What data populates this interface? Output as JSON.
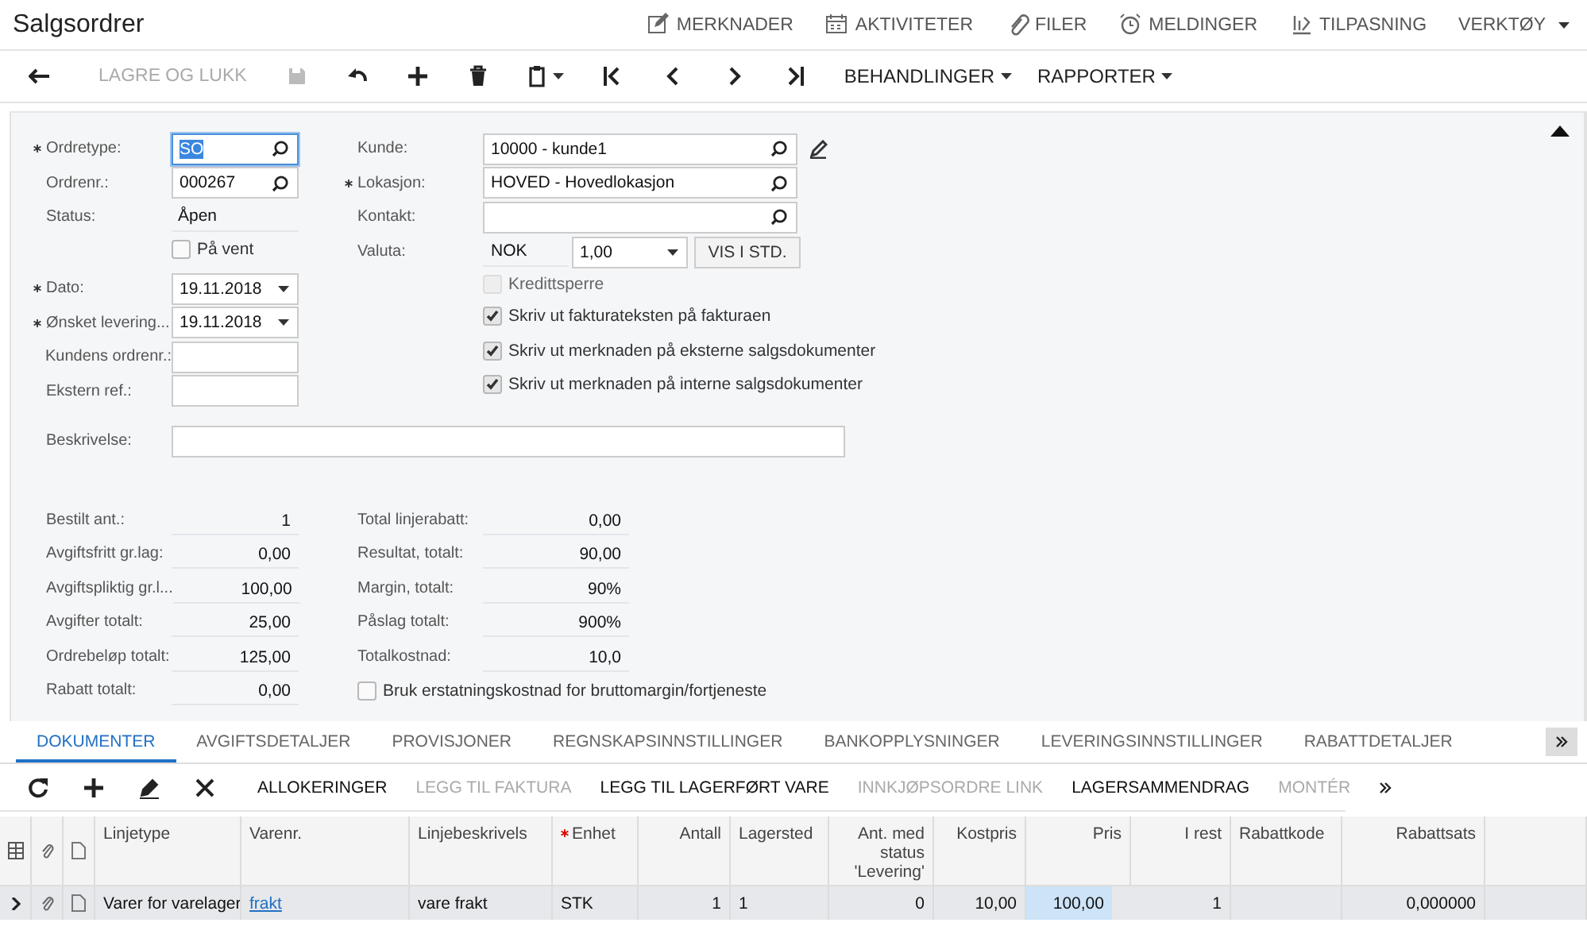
{
  "window": {
    "title": "Salgsordrer"
  },
  "header_actions": [
    {
      "label": "MERKNADER",
      "kind": "notes"
    },
    {
      "label": "AKTIVITETER",
      "kind": "calendar"
    },
    {
      "label": "FILER",
      "kind": "clip"
    },
    {
      "label": "MELDINGER",
      "kind": "clock"
    },
    {
      "label": "TILPASNING",
      "kind": "custom"
    },
    {
      "label": "VERKTØY",
      "kind": "menu"
    }
  ],
  "toolbar": {
    "save_close": {
      "label": "LAGRE OG LUKK",
      "disabled": true
    },
    "menus": [
      {
        "label": "BEHANDLINGER"
      },
      {
        "label": "RAPPORTER"
      }
    ]
  },
  "form": {
    "left": [
      {
        "kind": "lookup",
        "label": "Ordretype:",
        "required": true,
        "value": "SO",
        "focused": true
      },
      {
        "kind": "lookup",
        "label": "Ordrenr.:",
        "required": false,
        "value": "000267",
        "focused": false
      },
      {
        "kind": "status",
        "label": "Status:",
        "required": false,
        "value": "Åpen"
      },
      {
        "kind": "checkbox",
        "label": "På vent",
        "checked": false,
        "disabled": false
      },
      {
        "kind": "date",
        "label": "Dato:",
        "required": true,
        "value": "19.11.2018",
        "focused": false
      },
      {
        "kind": "date",
        "label": "Ønsket levering...",
        "required": true,
        "value": "19.11.2018",
        "focused": false
      },
      {
        "kind": "text",
        "label": "Kundens ordrenr.:",
        "required": false,
        "focused": false
      },
      {
        "kind": "text",
        "label": "Ekstern ref.:",
        "required": false,
        "focused": false
      }
    ],
    "right": [
      {
        "kind": "lookup",
        "label": "Kunde:",
        "required": false,
        "value": "10000 - kunde1",
        "focused": false,
        "editable": true
      },
      {
        "kind": "lookup",
        "label": "Lokasjon:",
        "required": true,
        "value": "HOVED - Hovedlokasjon",
        "focused": false,
        "editable": false
      },
      {
        "kind": "lookup",
        "label": "Kontakt:",
        "required": false,
        "focused": false,
        "editable": false
      },
      {
        "kind": "currency",
        "label": "Valuta:",
        "required": false,
        "value": "NOK",
        "rate": "1,00",
        "button": "VIS I STD."
      },
      {
        "kind": "checkbox",
        "label": "Kredittsperre",
        "checked": false,
        "disabled": true
      },
      {
        "kind": "checkbox",
        "label": "Skriv ut fakturateksten på fakturaen",
        "checked": true,
        "disabled": false
      },
      {
        "kind": "checkbox",
        "label": "Skriv ut merknaden på eksterne salgsdokumenter",
        "checked": true,
        "disabled": false
      },
      {
        "kind": "checkbox",
        "label": "Skriv ut merknaden på interne salgsdokumenter",
        "checked": true,
        "disabled": false
      }
    ],
    "description": {
      "label": "Beskrivelse:"
    }
  },
  "summary": {
    "left": [
      {
        "label": "Bestilt ant.:",
        "value": "1"
      },
      {
        "label": "Avgiftsfritt gr.lag:",
        "value": "0,00"
      },
      {
        "label": "Avgiftspliktig gr.l...",
        "value": "100,00"
      },
      {
        "label": "Avgifter totalt:",
        "value": "25,00"
      },
      {
        "label": "Ordrebeløp totalt:",
        "value": "125,00"
      },
      {
        "label": "Rabatt totalt:",
        "value": "0,00"
      }
    ],
    "right": [
      {
        "label": "Total linjerabatt:",
        "value": "0,00"
      },
      {
        "label": "Resultat, totalt:",
        "value": "90,00"
      },
      {
        "label": "Margin, totalt:",
        "value": "90%"
      },
      {
        "label": "Påslag totalt:",
        "value": "900%"
      },
      {
        "label": "Totalkostnad:",
        "value": "10,0"
      }
    ],
    "option": {
      "label": "Bruk erstatningskostnad for bruttomargin/fortjeneste",
      "checked": false
    }
  },
  "tabs": [
    {
      "label": "DOKUMENTER",
      "selected": true
    },
    {
      "label": "AVGIFTSDETALJER",
      "selected": false
    },
    {
      "label": "PROVISJONER",
      "selected": false
    },
    {
      "label": "REGNSKAPSINNSTILLINGER",
      "selected": false
    },
    {
      "label": "BANKOPPLYSNINGER",
      "selected": false
    },
    {
      "label": "LEVERINGSINNSTILLINGER",
      "selected": false
    },
    {
      "label": "RABATTDETALJER",
      "selected": false
    }
  ],
  "grid_toolbar": [
    {
      "label": "ALLOKERINGER",
      "disabled": false
    },
    {
      "label": "LEGG TIL FAKTURA",
      "disabled": true
    },
    {
      "label": "LEGG TIL LAGERFØRT VARE",
      "disabled": false
    },
    {
      "label": "INNKJØPSORDRE LINK",
      "disabled": true
    },
    {
      "label": "LAGERSAMMENDRAG",
      "disabled": false
    },
    {
      "label": "MONTÉR",
      "disabled": true
    }
  ],
  "table": {
    "columns": [
      {
        "label": "Linjetype",
        "required": false
      },
      {
        "label": "Varenr.",
        "required": false
      },
      {
        "label": "Linjebeskrivels",
        "required": false
      },
      {
        "label": "Enhet",
        "required": true
      },
      {
        "label": "Antall",
        "required": false
      },
      {
        "label": "Lagersted",
        "required": false
      },
      {
        "label": "Ant. med status 'Levering'",
        "required": false
      },
      {
        "label": "Kostpris",
        "required": false
      },
      {
        "label": "Pris",
        "required": false
      },
      {
        "label": "I rest",
        "required": false
      },
      {
        "label": "Rabattkode",
        "required": false
      },
      {
        "label": "Rabattsats",
        "required": false
      }
    ],
    "rows": [
      {
        "selected": true,
        "cells": [
          {
            "kind": "text",
            "text": "Varer for varelager",
            "selected": false
          },
          {
            "kind": "link",
            "text": "frakt",
            "selected": false
          },
          {
            "kind": "text",
            "text": "vare frakt",
            "selected": false
          },
          {
            "kind": "text",
            "text": "STK",
            "selected": false
          },
          {
            "kind": "text",
            "text": "1",
            "selected": false
          },
          {
            "kind": "text",
            "text": "1",
            "selected": false
          },
          {
            "kind": "text",
            "text": "0",
            "selected": false
          },
          {
            "kind": "text",
            "text": "10,00",
            "selected": false
          },
          {
            "kind": "text",
            "text": "100,00",
            "selected": true
          },
          {
            "kind": "text",
            "text": "1",
            "selected": false
          },
          {
            "kind": "empty",
            "selected": false
          },
          {
            "kind": "text",
            "text": "0,000000",
            "selected": false
          }
        ]
      }
    ]
  }
}
